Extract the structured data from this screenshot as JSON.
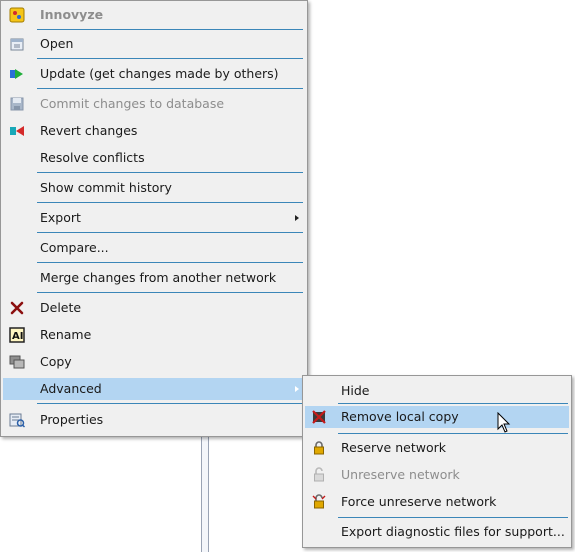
{
  "menu": {
    "title": "Innovyze",
    "items": [
      {
        "label": "Open"
      },
      {
        "label": "Update (get changes made by others)"
      },
      {
        "label": "Commit changes to database"
      },
      {
        "label": "Revert changes"
      },
      {
        "label": "Resolve conflicts"
      },
      {
        "label": "Show commit history"
      },
      {
        "label": "Export"
      },
      {
        "label": "Compare..."
      },
      {
        "label": "Merge changes from another network"
      },
      {
        "label": "Delete"
      },
      {
        "label": "Rename"
      },
      {
        "label": "Copy"
      },
      {
        "label": "Advanced"
      },
      {
        "label": "Properties"
      }
    ]
  },
  "submenu": {
    "items": [
      {
        "label": "Hide"
      },
      {
        "label": "Remove local copy"
      },
      {
        "label": "Reserve network"
      },
      {
        "label": "Unreserve network"
      },
      {
        "label": "Force unreserve network"
      },
      {
        "label": "Export diagnostic files for support..."
      }
    ]
  },
  "colors": {
    "menu_bg": "#f0f0f0",
    "highlight": "#b3d5f2",
    "separator": "#3b86b8",
    "disabled_text": "#8d8d8d"
  }
}
